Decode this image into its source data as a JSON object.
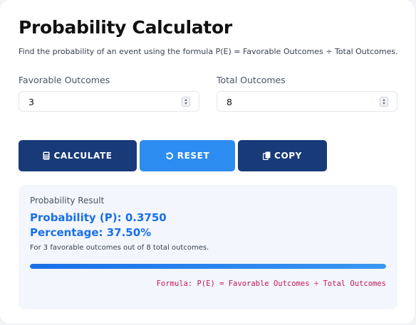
{
  "header": {
    "title": "Probability Calculator",
    "subtitle": "Find the probability of an event using the formula P(E) = Favorable Outcomes ÷ Total Outcomes."
  },
  "inputs": {
    "favorable": {
      "label": "Favorable Outcomes",
      "value": "3"
    },
    "total": {
      "label": "Total Outcomes",
      "value": "8"
    }
  },
  "buttons": {
    "calculate": {
      "label": "CALCULATE",
      "icon": "calculator-icon",
      "color": "#183a78"
    },
    "reset": {
      "label": "RESET",
      "icon": "undo-icon",
      "color": "#2d8cf0"
    },
    "copy": {
      "label": "COPY",
      "icon": "copy-icon",
      "color": "#183a78"
    }
  },
  "result": {
    "label": "Probability Result",
    "probability": "Probability (P): 0.3750",
    "percentage": "Percentage: 37.50%",
    "description": "For 3 favorable outcomes out of 8 total outcomes.",
    "progress_percent": 100,
    "formula": "Formula: P(E) = Favorable Outcomes ÷ Total Outcomes"
  },
  "colors": {
    "accent": "#1a6fe8",
    "formula": "#c2185b"
  }
}
